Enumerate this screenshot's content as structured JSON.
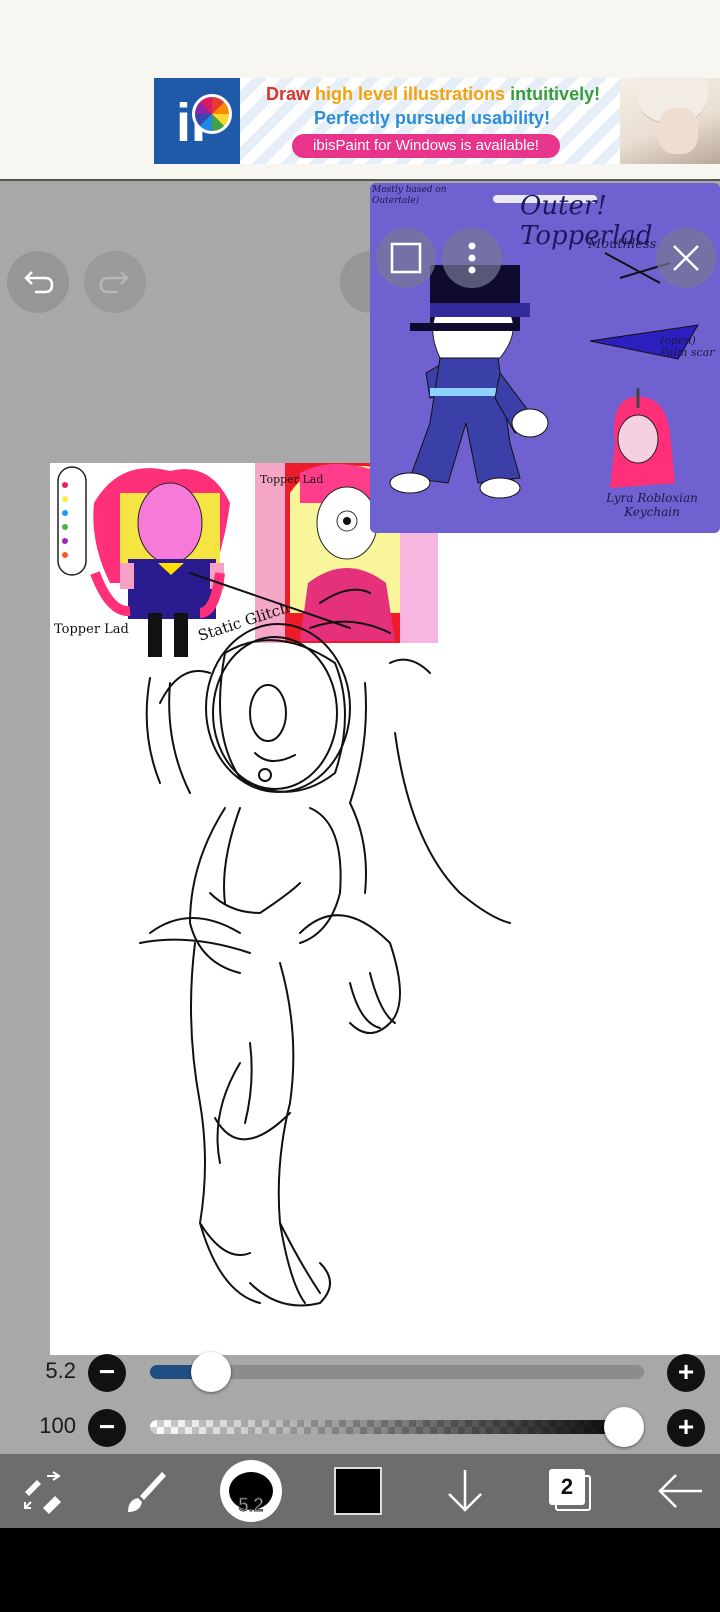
{
  "ad": {
    "logo_text": "iP",
    "line1_w1": "Draw ",
    "line1_w2": "high level illustrations ",
    "line1_w3": "intuitively!",
    "line2": "Perfectly pursued usability!",
    "pill": "ibisPaint for Windows is available!"
  },
  "reference": {
    "note": "Mostly based on Outertale)",
    "title": "Outer! Topperlad",
    "mouthless": "Mouthless",
    "open_label": "(open) Palm scar",
    "keychain": "Lyra Robloxian Keychain"
  },
  "canvas_labels": {
    "topper_lad": "Topper Lad",
    "static_glitch": "Static Glitch",
    "topper_lad_small": "Topper Lad"
  },
  "sliders": {
    "brush_size": "5.2",
    "brush_size_fraction": 0.09,
    "opacity": "100",
    "opacity_fraction": 1.0
  },
  "toolbar": {
    "brush_size_label": "5.2",
    "layer_count": "2",
    "current_color": "#000000"
  },
  "colors": {
    "reference_bg": "#6f62d0",
    "size_fill": "#1f4f82",
    "toolbar_bg": "#6d6d6d"
  }
}
